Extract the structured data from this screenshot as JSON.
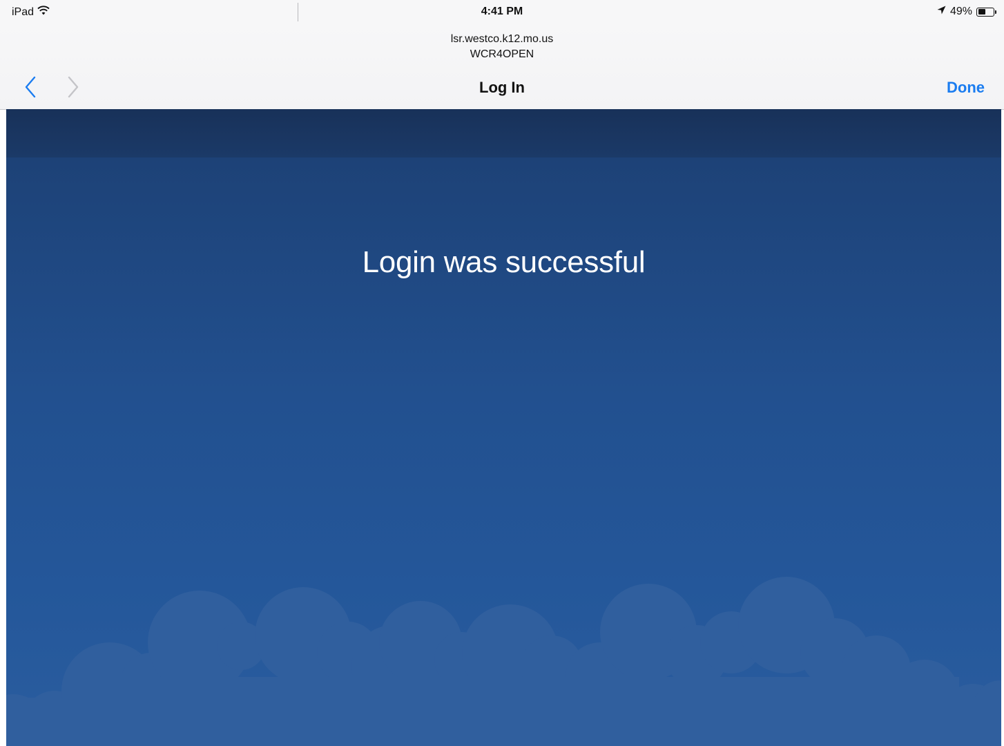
{
  "status_bar": {
    "device": "iPad",
    "time": "4:41 PM",
    "battery_text": "49%",
    "battery_level": 0.49,
    "icons": [
      "wifi-icon",
      "location-arrow-icon",
      "battery-icon"
    ]
  },
  "portal": {
    "host": "lsr.westco.k12.mo.us",
    "network": "WCR4OPEN",
    "title": "Log In",
    "done_label": "Done",
    "back_icon": "chevron-left-icon",
    "forward_icon": "chevron-right-icon",
    "accent_color": "#1a7cf0"
  },
  "page": {
    "message": "Login was successful",
    "background_color": "#24579a",
    "cloud_color": "#3060a0"
  }
}
